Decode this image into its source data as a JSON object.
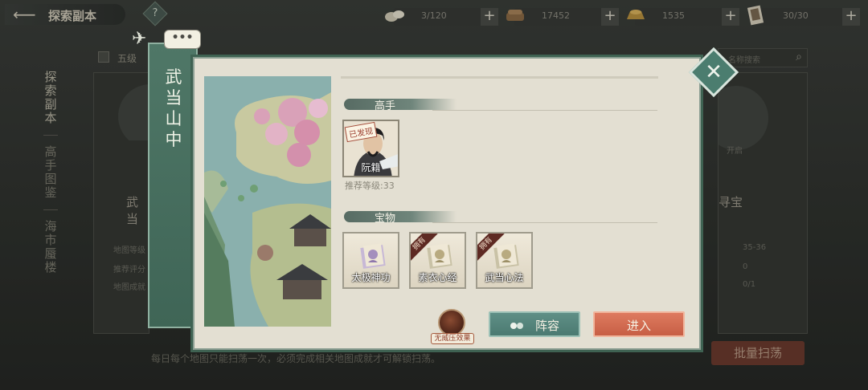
{
  "header": {
    "back_title": "探索副本",
    "help_label": "?"
  },
  "resources": [
    {
      "icon": "stone-resource-icon",
      "value": "3/120"
    },
    {
      "icon": "coin-resource-icon",
      "value": "17452"
    },
    {
      "icon": "gold-ingot-resource-icon",
      "value": "1535"
    },
    {
      "icon": "stamina-scroll-resource-icon",
      "value": "30/30"
    }
  ],
  "left_tabs": [
    "探索副本",
    "高手图鉴",
    "海市蜃楼"
  ],
  "background": {
    "filter_label": "五级",
    "search_placeholder": "名称搜索",
    "left_card_title": "武当",
    "right_card_title": "寻宝",
    "right_card_status": "开启",
    "stats_labels": [
      "地图等级",
      "推荐评分",
      "地图成就"
    ],
    "stats_values": [
      "35-36",
      "0",
      "0/1"
    ],
    "footer_text": "每日每个地图只能扫荡一次，必须完成相关地图成就才可解锁扫荡。",
    "batch_sweep": "批量扫荡"
  },
  "modal": {
    "location_title": "武当山中",
    "chat_icon": "•••",
    "masters_header": "高手",
    "master": {
      "name": "阮籍",
      "tag": "已发现"
    },
    "recommended_level": "推荐等级:33",
    "treasures_header": "宝物",
    "treasures": [
      {
        "name": "太极神功",
        "owned_tag": ""
      },
      {
        "name": "素衣心经",
        "owned_tag": "拥有"
      },
      {
        "name": "武当心法",
        "owned_tag": "拥有"
      }
    ],
    "no_suppression_label": "无威压效果",
    "lineup_button": "阵容",
    "enter_button": "进入",
    "close_icon": "close-icon"
  }
}
